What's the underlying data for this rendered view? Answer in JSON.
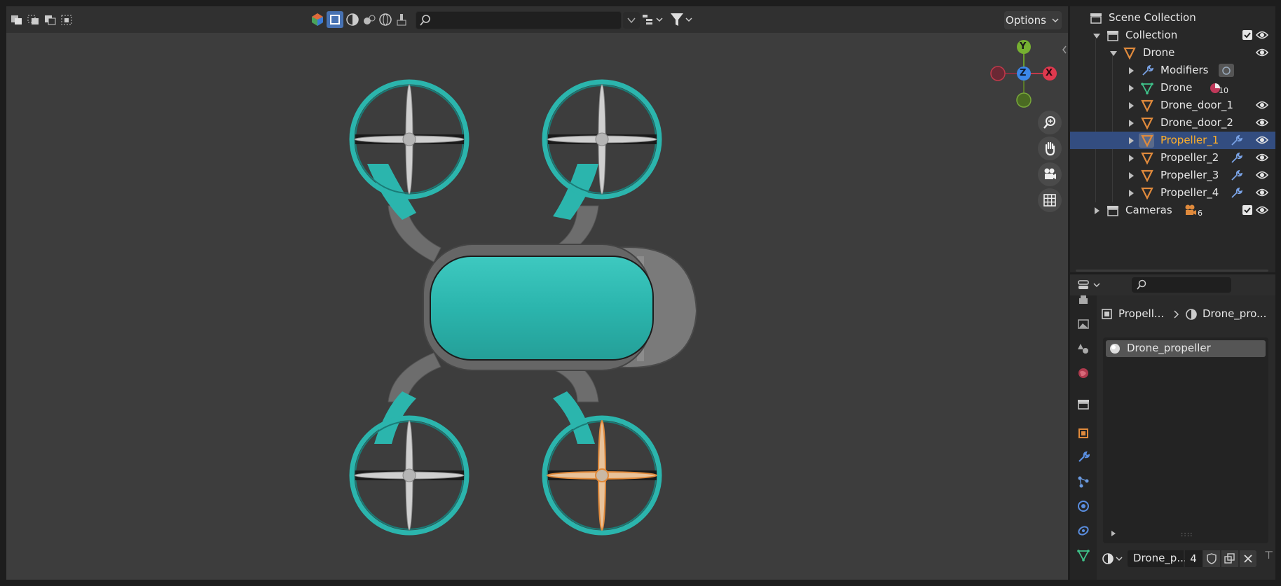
{
  "viewport": {
    "search_placeholder": "",
    "options_label": "Options",
    "gizmo": {
      "y": "Y",
      "z": "Z",
      "x": "X"
    }
  },
  "outliner": {
    "rows": [
      {
        "label": "Scene Collection"
      },
      {
        "label": "Collection"
      },
      {
        "label": "Drone"
      },
      {
        "label": "Modifiers"
      },
      {
        "label": "Drone",
        "badge": "10"
      },
      {
        "label": "Drone_door_1"
      },
      {
        "label": "Drone_door_2"
      },
      {
        "label": "Propeller_1"
      },
      {
        "label": "Propeller_2"
      },
      {
        "label": "Propeller_3"
      },
      {
        "label": "Propeller_4"
      },
      {
        "label": "Cameras",
        "badge": "6"
      }
    ],
    "selected": "Propeller_1"
  },
  "properties": {
    "breadcrumb_object": "Propell...",
    "breadcrumb_material": "Drone_pro...",
    "material_slot": "Drone_propeller",
    "material_name": "Drone_p...",
    "user_count": "4"
  },
  "colors": {
    "accent_select": "#334d80",
    "drone_teal": "#2bb5ad",
    "selected_text": "#ffaf29",
    "object_orange": "#e08a3c"
  }
}
